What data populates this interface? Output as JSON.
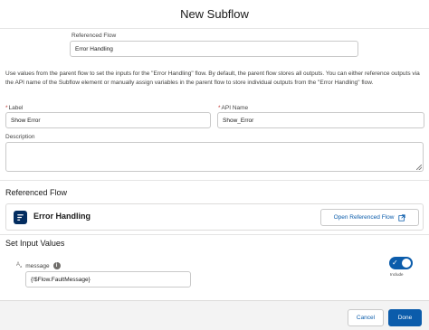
{
  "modal": {
    "title": "New Subflow"
  },
  "referenced_flow_field": {
    "label": "Referenced Flow",
    "value": "Error Handling"
  },
  "description_text": "Use values from the parent flow to set the inputs for the \"Error Handling\" flow. By default, the parent flow stores all outputs. You can either reference outputs via the API name of the Subflow element or manually assign variables in the parent flow to store individual outputs from the \"Error Handling\" flow.",
  "label_field": {
    "required_mark": "*",
    "label": "Label",
    "value": "Show Error"
  },
  "api_name_field": {
    "required_mark": "*",
    "label": "API Name",
    "value": "Show_Error"
  },
  "description_field": {
    "label": "Description",
    "value": ""
  },
  "referenced_flow_section": {
    "title": "Referenced Flow",
    "card_title": "Error Handling",
    "open_button_label": "Open Referenced Flow",
    "icon": "flow-icon"
  },
  "input_values_section": {
    "title": "Set Input Values",
    "param_type_icon": "text-type-icon",
    "param_label": "message",
    "param_value": "{!$Flow.FaultMessage}",
    "include_toggle": {
      "checked": true,
      "caption": "Include"
    }
  },
  "footer": {
    "cancel_label": "Cancel",
    "done_label": "Done"
  },
  "colors": {
    "brand": "#0b5cab",
    "flow_icon_bg": "#032d60",
    "required": "#c23934"
  }
}
